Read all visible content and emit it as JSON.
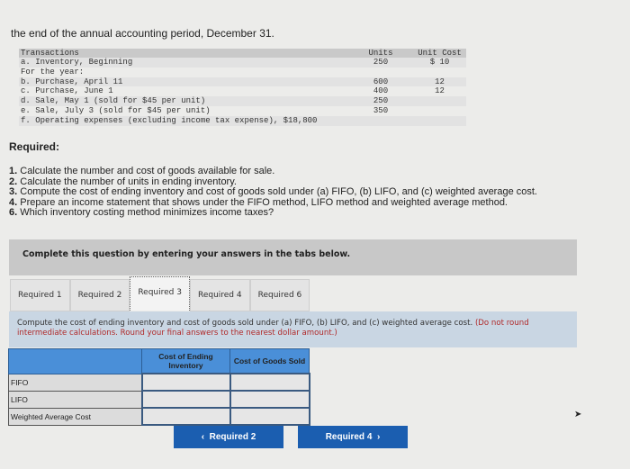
{
  "intro_text": "the end of the annual accounting period, December 31.",
  "transactions": {
    "header": {
      "label": "Transactions",
      "units": "Units",
      "unit_cost": "Unit Cost"
    },
    "rows": [
      {
        "label": "a. Inventory, Beginning",
        "units": "250",
        "unit_cost": "$ 10"
      },
      {
        "label": "For the year:",
        "units": "",
        "unit_cost": ""
      },
      {
        "label": "b. Purchase, April 11",
        "units": "600",
        "unit_cost": "12"
      },
      {
        "label": "c. Purchase, June 1",
        "units": "400",
        "unit_cost": "12"
      },
      {
        "label": "d. Sale, May 1 (sold for $45 per unit)",
        "units": "250",
        "unit_cost": ""
      },
      {
        "label": "e. Sale, July 3 (sold for $45 per unit)",
        "units": "350",
        "unit_cost": ""
      },
      {
        "label": "f. Operating expenses (excluding income tax expense), $18,800",
        "units": "",
        "unit_cost": ""
      }
    ]
  },
  "required": {
    "title": "Required:",
    "items": [
      {
        "num": "1.",
        "text": " Calculate the number and cost of goods available for sale."
      },
      {
        "num": "2.",
        "text": " Calculate the number of units in ending inventory."
      },
      {
        "num": "3.",
        "text": " Compute the cost of ending inventory and cost of goods sold under (a) FIFO, (b) LIFO, and (c) weighted average cost."
      },
      {
        "num": "4.",
        "text": " Prepare an income statement that shows under the FIFO method, LIFO method and weighted average method."
      },
      {
        "num": "6.",
        "text": " Which inventory costing method minimizes income taxes?"
      }
    ]
  },
  "complete_banner": "Complete this question by entering your answers in the tabs below.",
  "tabs": [
    {
      "label": "Required 1",
      "active": false
    },
    {
      "label": "Required 2",
      "active": false
    },
    {
      "label": "Required 3",
      "active": true
    },
    {
      "label": "Required 4",
      "active": false
    },
    {
      "label": "Required 6",
      "active": false
    }
  ],
  "instruction": {
    "main": "Compute the cost of ending inventory and cost of goods sold under (a) FIFO, (b) LIFO, and (c) weighted average cost.",
    "note": " (Do not round intermediate calculations. Round your final answers to the nearest dollar amount.)"
  },
  "answer_table": {
    "columns": [
      "",
      "Cost of Ending Inventory",
      "Cost of Goods Sold"
    ],
    "rows": [
      {
        "label": "FIFO",
        "ending_inventory": "",
        "cogs": ""
      },
      {
        "label": "LIFO",
        "ending_inventory": "",
        "cogs": ""
      },
      {
        "label": "Weighted Average Cost",
        "ending_inventory": "",
        "cogs": ""
      }
    ]
  },
  "nav": {
    "prev_label": "Required 2",
    "next_label": "Required 4",
    "prev_icon": "‹",
    "next_icon": "›"
  }
}
